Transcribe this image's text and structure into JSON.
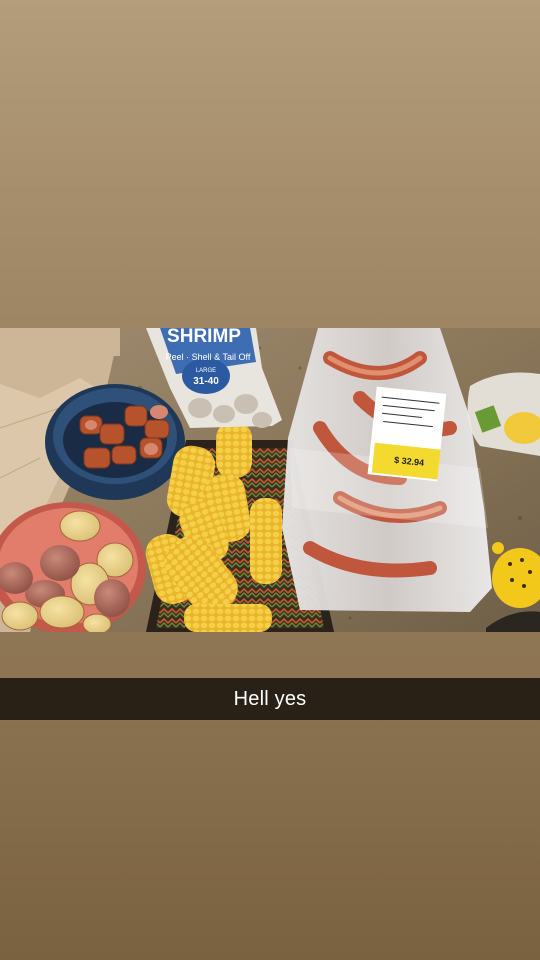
{
  "caption": {
    "text": "Hell yes"
  },
  "photo": {
    "shrimp_bag": {
      "brand": "SHRIMP",
      "tagline": "Peel · Shell & Tail Off",
      "size_label": "LARGE",
      "count": "31-40"
    },
    "crab_bag": {
      "price_tag": "$ 32.94"
    }
  },
  "colors": {
    "background_top": "#b39d7b",
    "background_bottom": "#7a6140",
    "caption_bar": "#211b12",
    "caption_text": "#ffffff"
  }
}
